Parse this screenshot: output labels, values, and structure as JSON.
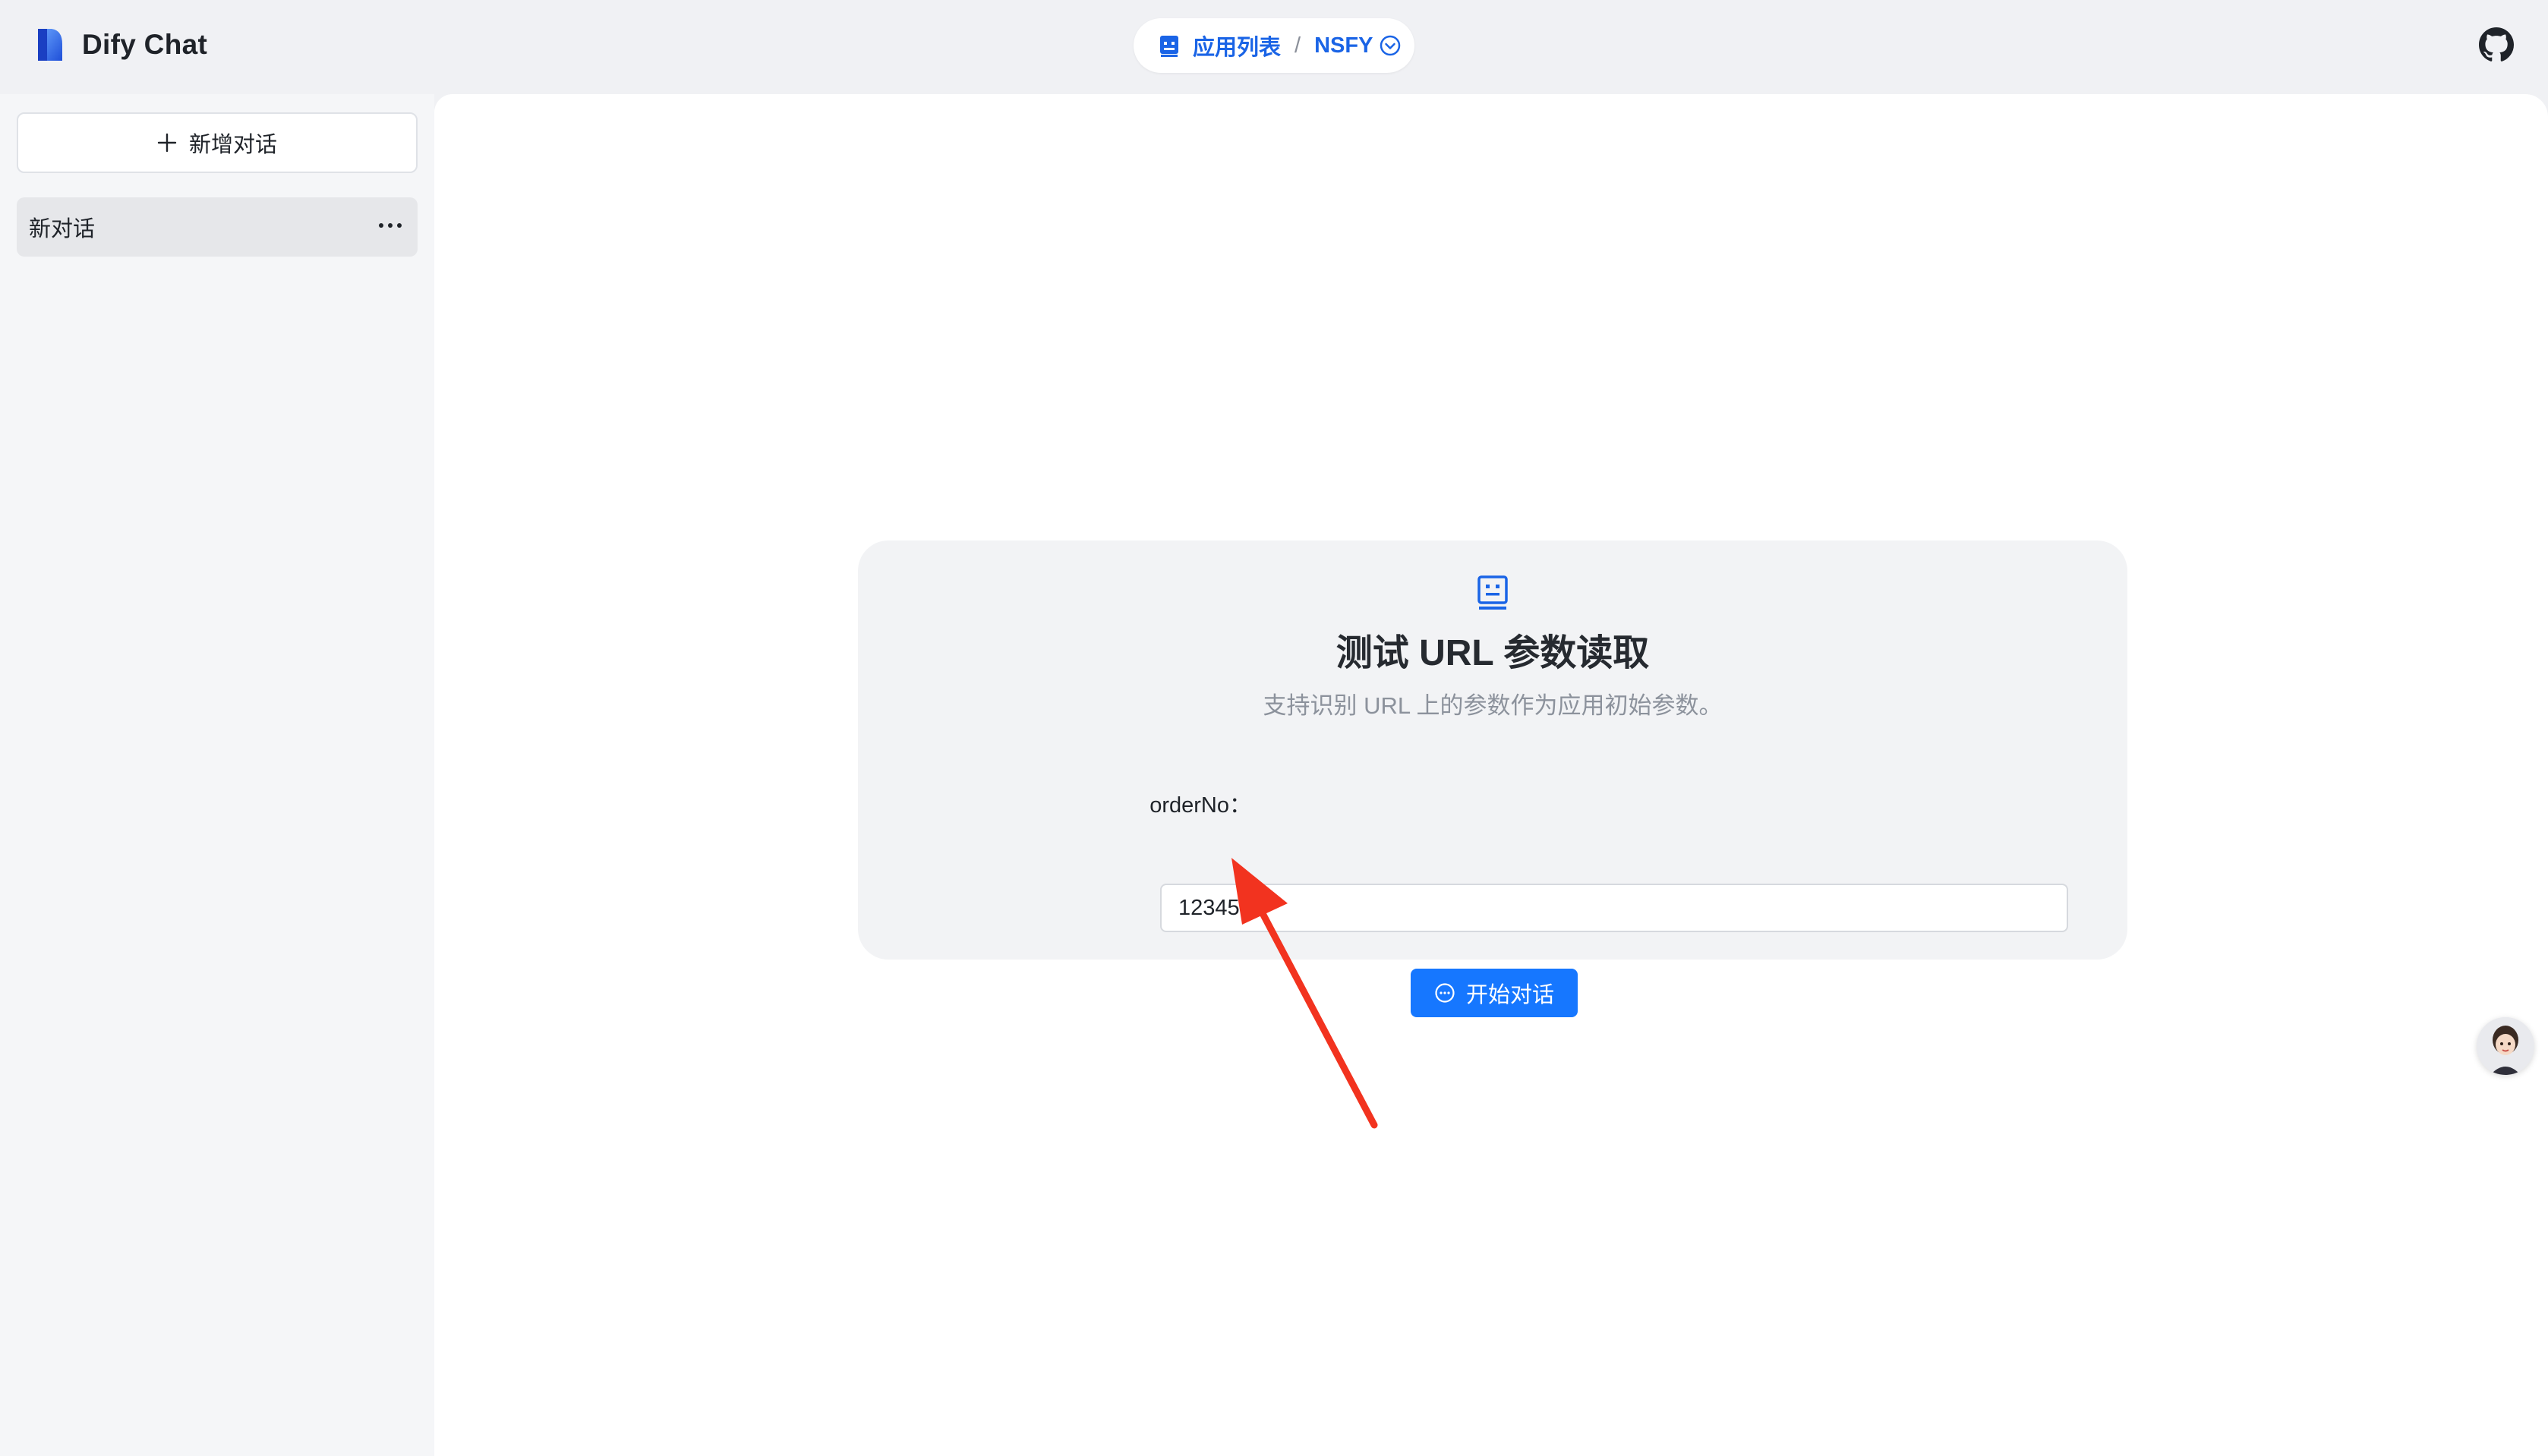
{
  "header": {
    "brand_title": "Dify Chat",
    "app_list_label": "应用列表",
    "separator": "/",
    "current_app": "NSFY",
    "github_icon": "github-icon"
  },
  "sidebar": {
    "new_conversation_label": "新增对话",
    "conversations": [
      {
        "title": "新对话"
      }
    ]
  },
  "card": {
    "title": "测试 URL 参数读取",
    "description": "支持识别 URL 上的参数作为应用初始参数。",
    "field_label": "orderNo：",
    "field_value": "12345",
    "start_button_label": "开始对话"
  },
  "colors": {
    "accent": "#1677ff",
    "link_blue": "#1a64e6",
    "annotation_arrow": "#f2331f"
  }
}
